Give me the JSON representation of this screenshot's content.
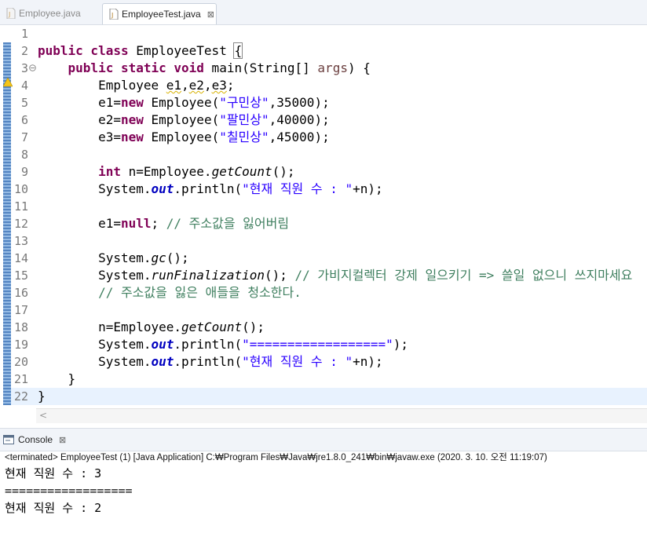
{
  "tabs": [
    {
      "label": "Employee.java",
      "active": false
    },
    {
      "label": "EmployeeTest.java",
      "active": true,
      "close": "⊠"
    }
  ],
  "line_numbers": [
    "1",
    "2",
    "3",
    "4",
    "5",
    "6",
    "7",
    "8",
    "9",
    "10",
    "11",
    "12",
    "13",
    "14",
    "15",
    "16",
    "17",
    "18",
    "19",
    "20",
    "21",
    "22"
  ],
  "code": {
    "l2_kw": "public class",
    "l2_name": " EmployeeTest ",
    "l2_brace": "{",
    "l3_kw": "public static void",
    "l3_rest": " main(String[] ",
    "l3_param": "args",
    "l3_end": ") {",
    "l4_type": "Employee ",
    "l4_v1": "e1",
    "l4_c1": ",",
    "l4_v2": "e2",
    "l4_c2": ",",
    "l4_v3": "e3",
    "l4_end": ";",
    "l5_a": "e1=",
    "l5_kw": "new",
    "l5_b": " Employee(",
    "l5_str": "\"구민상\"",
    "l5_c": ",35000);",
    "l6_a": "e2=",
    "l6_kw": "new",
    "l6_b": " Employee(",
    "l6_str": "\"팔민상\"",
    "l6_c": ",40000);",
    "l7_a": "e3=",
    "l7_kw": "new",
    "l7_b": " Employee(",
    "l7_str": "\"칠민상\"",
    "l7_c": ",45000);",
    "l9_kw": "int",
    "l9_a": " n=Employee.",
    "l9_m": "getCount",
    "l9_b": "();",
    "l10_a": "System.",
    "l10_f": "out",
    "l10_b": ".println(",
    "l10_str": "\"현재 직원 수 : \"",
    "l10_c": "+n);",
    "l12_a": "e1=",
    "l12_kw": "null",
    "l12_b": "; ",
    "l12_cm": "// 주소값을 잃어버림",
    "l14_a": "System.",
    "l14_m": "gc",
    "l14_b": "();",
    "l15_a": "System.",
    "l15_m": "runFinalization",
    "l15_b": "(); ",
    "l15_cm": "// 가비지컬렉터 강제 일으키기 => 쓸일 없으니 쓰지마세요",
    "l16_cm": "// 주소값을 잃은 애들을 청소한다.",
    "l18_a": "n=Employee.",
    "l18_m": "getCount",
    "l18_b": "();",
    "l19_a": "System.",
    "l19_f": "out",
    "l19_b": ".println(",
    "l19_str": "\"==================\"",
    "l19_c": ");",
    "l20_a": "System.",
    "l20_f": "out",
    "l20_b": ".println(",
    "l20_str": "\"현재 직원 수 : \"",
    "l20_c": "+n);",
    "l21": "}",
    "l22": "}"
  },
  "scroll_left": "<",
  "console": {
    "tab_label": "Console",
    "close": "⊠",
    "status": "<terminated> EmployeeTest (1) [Java Application] C:₩Program Files₩Java₩jre1.8.0_241₩bin₩javaw.exe (2020. 3. 10. 오전 11:19:07)",
    "output": [
      "현재 직원 수 : 3",
      "==================",
      "현재 직원 수 : 2"
    ]
  },
  "colors": {
    "keyword": "#7f0055",
    "string": "#2a00ff",
    "comment": "#3f7f5f",
    "field": "#0000c0"
  }
}
